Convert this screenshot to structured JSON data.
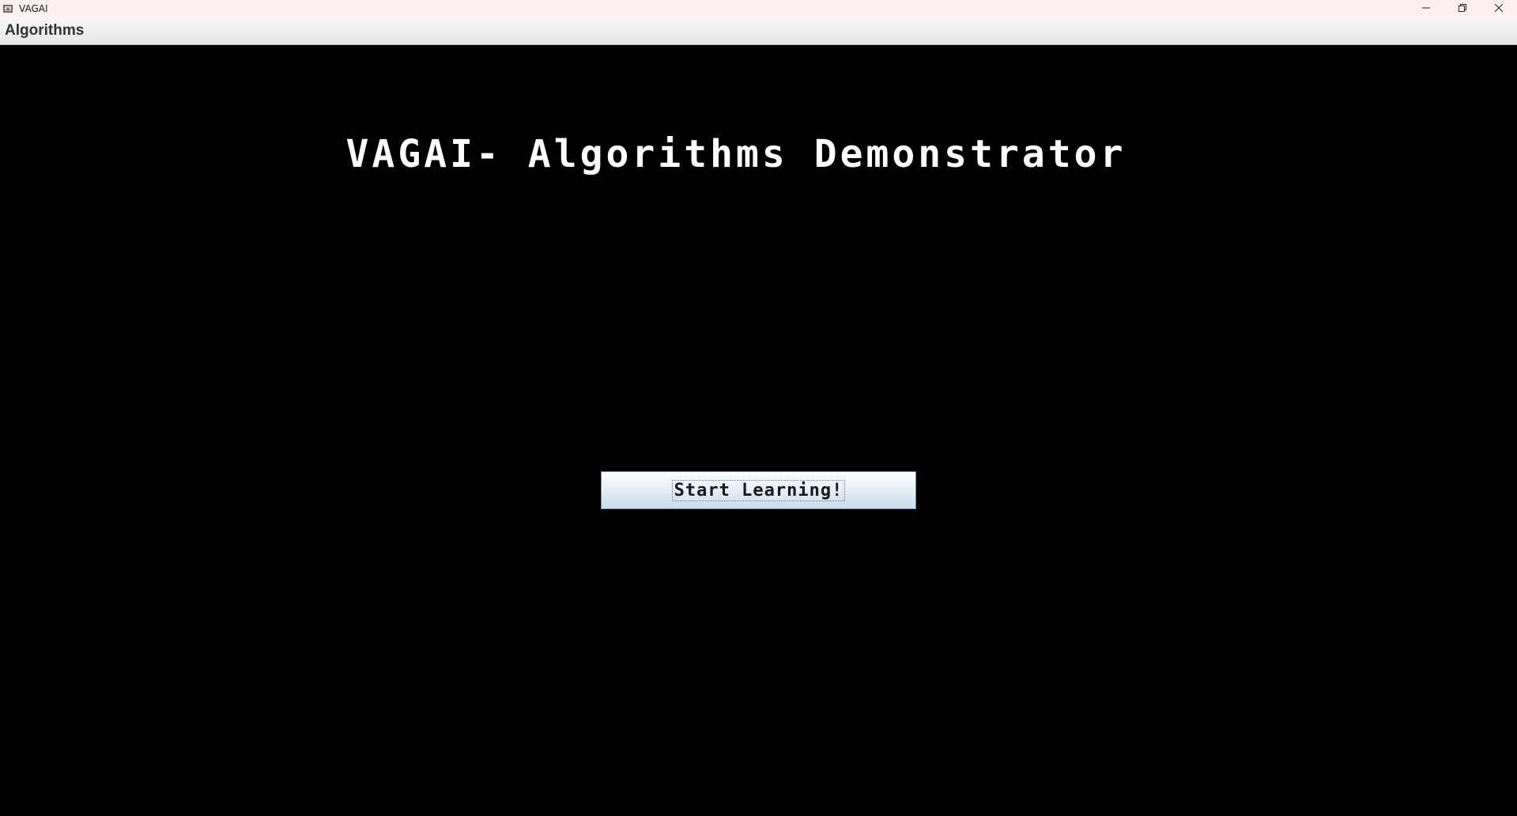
{
  "window": {
    "title": "VAGAI",
    "controls": {
      "minimize_icon": "minimize-icon",
      "restore_icon": "restore-icon",
      "close_icon": "close-icon"
    }
  },
  "menubar": {
    "items": [
      {
        "label": "Algorithms"
      }
    ]
  },
  "main": {
    "title": "VAGAI- Algorithms Demonstrator",
    "start_button_label": "Start Learning!"
  },
  "colors": {
    "background": "#000000",
    "title_text": "#ffffff",
    "titlebar": "#fbf0ef",
    "button_top": "#ffffff",
    "button_bottom": "#c9dcee"
  }
}
